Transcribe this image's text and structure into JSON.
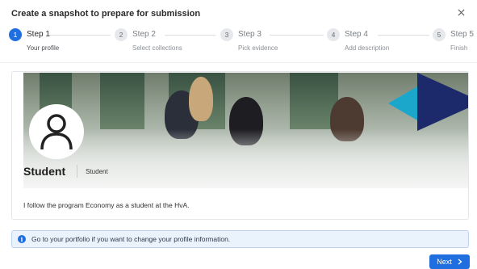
{
  "dialog": {
    "title": "Create a snapshot to prepare for submission",
    "close_icon": "close-icon"
  },
  "stepper": {
    "steps": [
      {
        "number": "1",
        "title": "Step 1",
        "subtitle": "Your profile",
        "active": true
      },
      {
        "number": "2",
        "title": "Step 2",
        "subtitle": "Select collections",
        "active": false
      },
      {
        "number": "3",
        "title": "Step 3",
        "subtitle": "Pick evidence",
        "active": false
      },
      {
        "number": "4",
        "title": "Step 4",
        "subtitle": "Add description",
        "active": false
      },
      {
        "number": "5",
        "title": "Step 5",
        "subtitle": "Finish",
        "active": false
      }
    ]
  },
  "profile": {
    "name": "Student",
    "role": "Student",
    "bio": "I follow the program Economy as a student at the HvA.",
    "avatar_icon": "user-icon"
  },
  "info": {
    "icon": "info-icon",
    "text": "Go to your portfolio if you want to change your profile information."
  },
  "footer": {
    "next_label": "Next",
    "next_icon": "chevron-right-icon"
  },
  "colors": {
    "accent": "#1f6fe0",
    "info_bg": "#eaf2fc",
    "banner_cyan": "#1ba6cc",
    "banner_navy": "#1c2a6b"
  }
}
